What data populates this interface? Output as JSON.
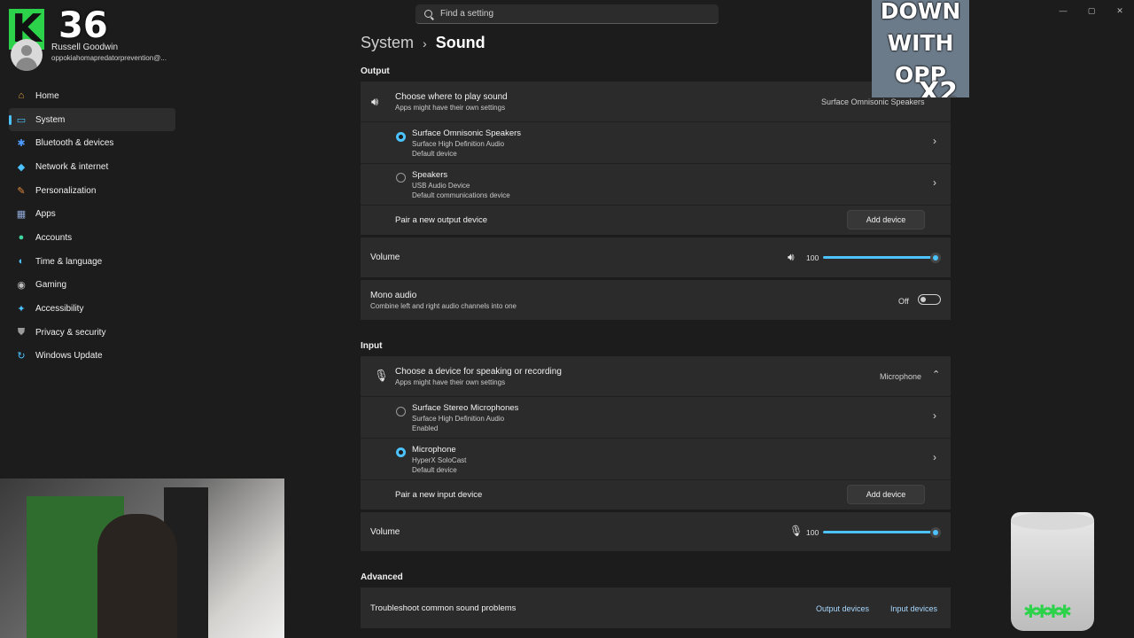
{
  "profile": {
    "name": "Russell Goodwin",
    "email": "oppokiahomapredatorprevention@..."
  },
  "overlay": {
    "brand_letter": "K",
    "counter": "36",
    "meme_lines": [
      "DOWN",
      "WITH",
      "OPP",
      "X2"
    ]
  },
  "search": {
    "placeholder": "Find a setting"
  },
  "window_controls": [
    "—",
    "▢",
    "✕"
  ],
  "nav": {
    "items": [
      {
        "label": "Home",
        "icon": "home-icon",
        "color": "#e8a33d",
        "glyph": "⌂"
      },
      {
        "label": "System",
        "icon": "system-icon",
        "color": "#4cc2ff",
        "glyph": "▭",
        "selected": true
      },
      {
        "label": "Bluetooth & devices",
        "icon": "bluetooth-icon",
        "color": "#4c9bff",
        "glyph": "✱"
      },
      {
        "label": "Network & internet",
        "icon": "network-icon",
        "color": "#4cc2ff",
        "glyph": "◆"
      },
      {
        "label": "Personalization",
        "icon": "brush-icon",
        "color": "#e88b3d",
        "glyph": "✎"
      },
      {
        "label": "Apps",
        "icon": "apps-icon",
        "color": "#8fa9d8",
        "glyph": "▦"
      },
      {
        "label": "Accounts",
        "icon": "accounts-icon",
        "color": "#3ed7a0",
        "glyph": "●"
      },
      {
        "label": "Time & language",
        "icon": "globe-icon",
        "color": "#4cc2ff",
        "glyph": "◐"
      },
      {
        "label": "Gaming",
        "icon": "gamepad-icon",
        "color": "#bdbdbd",
        "glyph": "◉"
      },
      {
        "label": "Accessibility",
        "icon": "accessibility-icon",
        "color": "#4cc2ff",
        "glyph": "✦"
      },
      {
        "label": "Privacy & security",
        "icon": "shield-icon",
        "color": "#9a9a9a",
        "glyph": "⛊"
      },
      {
        "label": "Windows Update",
        "icon": "update-icon",
        "color": "#4cc2ff",
        "glyph": "↻"
      }
    ]
  },
  "breadcrumb": {
    "parent": "System",
    "separator": "›",
    "current": "Sound"
  },
  "output": {
    "section_label": "Output",
    "chooser": {
      "title": "Choose where to play sound",
      "subtitle": "Apps might have their own settings",
      "selected": "Surface Omnisonic Speakers"
    },
    "devices": [
      {
        "name": "Surface Omnisonic Speakers",
        "line1": "Surface High Definition Audio",
        "line2": "Default device",
        "selected": true
      },
      {
        "name": "Speakers",
        "line1": "USB Audio Device",
        "line2": "Default communications device",
        "selected": false
      }
    ],
    "pair": {
      "label": "Pair a new output device",
      "button": "Add device"
    },
    "volume": {
      "label": "Volume",
      "value": "100",
      "level": 100
    },
    "mono": {
      "title": "Mono audio",
      "subtitle": "Combine left and right audio channels into one",
      "state": "Off"
    }
  },
  "input": {
    "section_label": "Input",
    "chooser": {
      "title": "Choose a device for speaking or recording",
      "subtitle": "Apps might have their own settings",
      "selected": "Microphone"
    },
    "devices": [
      {
        "name": "Surface Stereo Microphones",
        "line1": "Surface High Definition Audio",
        "line2": "Enabled",
        "selected": false
      },
      {
        "name": "Microphone",
        "line1": "HyperX SoloCast",
        "line2": "Default device",
        "selected": true
      }
    ],
    "pair": {
      "label": "Pair a new input device",
      "button": "Add device"
    },
    "volume": {
      "label": "Volume",
      "value": "100",
      "level": 100
    }
  },
  "advanced": {
    "section_label": "Advanced",
    "troubleshoot": {
      "label": "Troubleshoot common sound problems",
      "link1": "Output devices",
      "link2": "Input devices"
    }
  },
  "colors": {
    "accent": "#4cc2ff",
    "background": "#1c1c1c",
    "card": "#2b2b2b"
  }
}
